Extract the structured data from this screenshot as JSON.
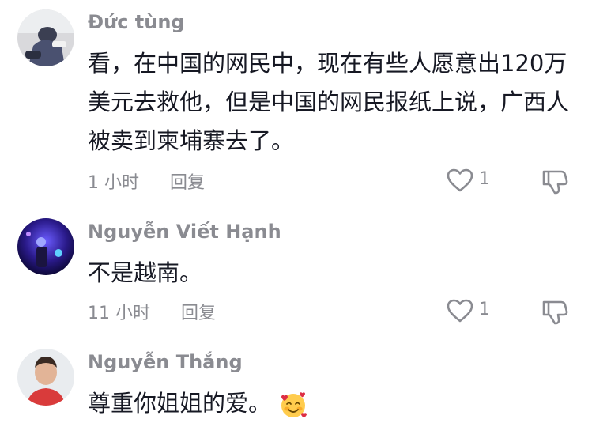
{
  "comments": [
    {
      "username": "Đức tùng",
      "text": "看，在中国的网民中，现在有些人愿意出120万美元去救他，但是中国的网民报纸上说，广西人被卖到柬埔寨去了。",
      "time": "1 小时",
      "reply_label": "回复",
      "like_count": "1"
    },
    {
      "username": "Nguyễn Viết Hạnh",
      "text": "不是越南。",
      "time": "11 小时",
      "reply_label": "回复",
      "like_count": "1"
    },
    {
      "username": "Nguyễn Thắng",
      "text": "尊重你姐姐的爱。",
      "emoji": "smiling-face-with-hearts"
    }
  ],
  "colors": {
    "text": "#161823",
    "secondary": "#8a8b91"
  },
  "icons": {
    "like": "heart-outline-icon",
    "dislike": "thumbs-down-icon"
  }
}
